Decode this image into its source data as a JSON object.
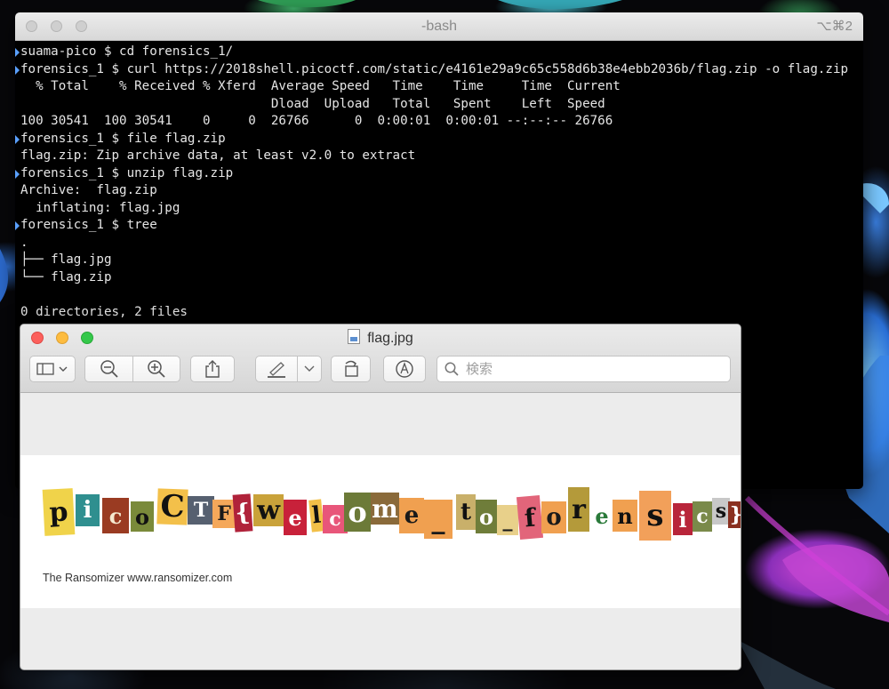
{
  "terminal": {
    "title": "-bash",
    "shortcut": "⌥⌘2",
    "lines": [
      {
        "text": "suama-pico $ cd forensics_1/",
        "prompt": true
      },
      {
        "text": "forensics_1 $ curl https://2018shell.picoctf.com/static/e4161e29a9c65c558d6b38e4ebb2036b/flag.zip -o flag.zip",
        "prompt": true
      },
      {
        "text": "  % Total    % Received % Xferd  Average Speed   Time    Time     Time  Current",
        "prompt": false
      },
      {
        "text": "                                 Dload  Upload   Total   Spent    Left  Speed",
        "prompt": false
      },
      {
        "text": "100 30541  100 30541    0     0  26766      0  0:00:01  0:00:01 --:--:-- 26766",
        "prompt": false
      },
      {
        "text": "forensics_1 $ file flag.zip",
        "prompt": true
      },
      {
        "text": "flag.zip: Zip archive data, at least v2.0 to extract",
        "prompt": false
      },
      {
        "text": "forensics_1 $ unzip flag.zip",
        "prompt": true
      },
      {
        "text": "Archive:  flag.zip",
        "prompt": false
      },
      {
        "text": "  inflating: flag.jpg",
        "prompt": false
      },
      {
        "text": "forensics_1 $ tree",
        "prompt": true
      },
      {
        "text": ".",
        "prompt": false
      },
      {
        "text": "├── flag.jpg",
        "prompt": false
      },
      {
        "text": "└── flag.zip",
        "prompt": false
      },
      {
        "text": "",
        "prompt": false
      },
      {
        "text": "0 directories, 2 files",
        "prompt": false
      }
    ]
  },
  "preview": {
    "title": "flag.jpg",
    "search_placeholder": "検索",
    "toolbar_icons": [
      "sidebar-icon",
      "chevron-down-icon",
      "zoom-out-icon",
      "zoom-in-icon",
      "share-icon",
      "markup-pen-icon",
      "chevron-down-icon",
      "rotate-icon",
      "annotate-icon",
      "search-icon"
    ],
    "image": {
      "ransom_letters": [
        {
          "ch": "p",
          "bg": "#f0d34a",
          "fg": "#111111"
        },
        {
          "ch": "i",
          "bg": "#2f8f8f",
          "fg": "#ffffff"
        },
        {
          "ch": "c",
          "bg": "#9a3b22",
          "fg": "#f5e9d0"
        },
        {
          "ch": "o",
          "bg": "#7a8a3a",
          "fg": "#111111"
        },
        {
          "ch": "C",
          "bg": "#f3c04a",
          "fg": "#111111"
        },
        {
          "ch": "T",
          "bg": "#566070",
          "fg": "#ffffff"
        },
        {
          "ch": "F",
          "bg": "#f5a85a",
          "fg": "#1a1a1a"
        },
        {
          "ch": "{",
          "bg": "#b0223a",
          "fg": "#ffffff"
        },
        {
          "ch": "w",
          "bg": "#c9a23a",
          "fg": "#111111"
        },
        {
          "ch": "e",
          "bg": "#c8213a",
          "fg": "#ffffff"
        },
        {
          "ch": "l",
          "bg": "#f2c048",
          "fg": "#111111"
        },
        {
          "ch": "c",
          "bg": "#e8567a",
          "fg": "#ffffff"
        },
        {
          "ch": "o",
          "bg": "#6c7a38",
          "fg": "#ffffff"
        },
        {
          "ch": "m",
          "bg": "#8a6a3a",
          "fg": "#ffffff"
        },
        {
          "ch": "e",
          "bg": "#f0a050",
          "fg": "#1a1a1a"
        },
        {
          "ch": "_",
          "bg": "#f0a050",
          "fg": "#1a1a1a"
        },
        {
          "ch": "t",
          "bg": "#c9b06a",
          "fg": "#111111"
        },
        {
          "ch": "o",
          "bg": "#6f7d3a",
          "fg": "#ffffff"
        },
        {
          "ch": "_",
          "bg": "#e8d08a",
          "fg": "#1a1a1a"
        },
        {
          "ch": "f",
          "bg": "#e2657a",
          "fg": "#111111"
        },
        {
          "ch": "o",
          "bg": "#f0a050",
          "fg": "#1a1a1a"
        },
        {
          "ch": "r",
          "bg": "#b49a3a",
          "fg": "#111111"
        },
        {
          "ch": "e",
          "bg": "#ffffff",
          "fg": "#2a7a3a"
        },
        {
          "ch": "n",
          "bg": "#f0a050",
          "fg": "#111111"
        },
        {
          "ch": "s",
          "bg": "#f2a05a",
          "fg": "#111111"
        },
        {
          "ch": "i",
          "bg": "#b8253a",
          "fg": "#ffffff"
        },
        {
          "ch": "c",
          "bg": "#7a8a4a",
          "fg": "#ffffff"
        },
        {
          "ch": "s",
          "bg": "#c8c8c8",
          "fg": "#111111"
        },
        {
          "ch": "}",
          "bg": "#8a3020",
          "fg": "#ffffff"
        }
      ],
      "credit": "The Ransomizer www.ransomizer.com"
    }
  }
}
